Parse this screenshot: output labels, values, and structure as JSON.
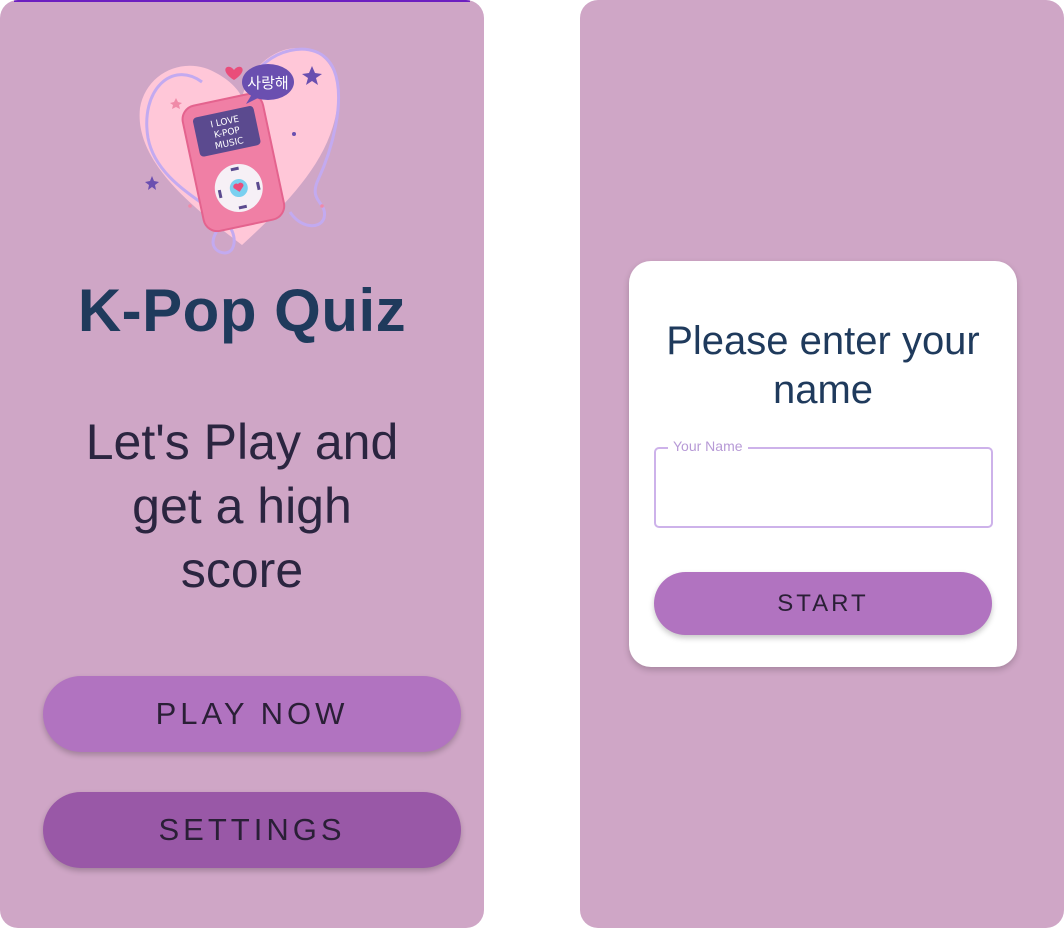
{
  "home": {
    "app_title": "K-Pop Quiz",
    "tagline_lines": [
      "Let's Play and",
      "get a high",
      "score"
    ],
    "play_label": "PLAY NOW",
    "settings_label": "SETTINGS",
    "illustration": {
      "bubble_text": "사랑해",
      "screen_lines": [
        "I LOVE",
        "K-POP",
        "MUSIC"
      ]
    }
  },
  "name_screen": {
    "title_lines": [
      "Please enter your",
      "name"
    ],
    "name_field": {
      "label": "Your Name",
      "value": ""
    },
    "start_label": "START"
  },
  "colors": {
    "screen_bg": "#cfa6c6",
    "primary_button": "#b173c0",
    "secondary_button": "#9958a7",
    "title_text": "#1f3a5c",
    "field_outline": "#cdb2ea"
  }
}
